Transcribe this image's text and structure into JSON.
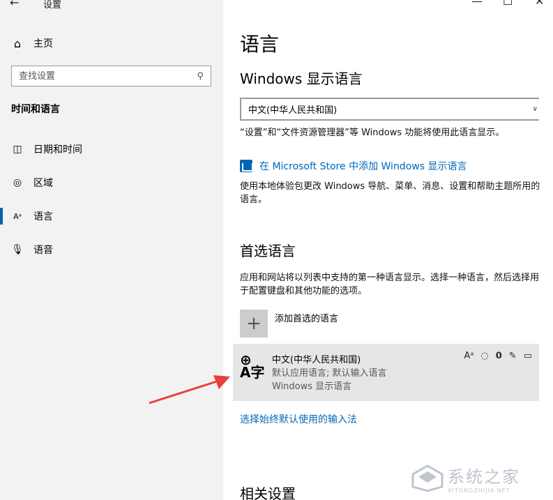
{
  "window": {
    "title": "设置",
    "back_glyph": "←",
    "minimize_glyph": "—",
    "maximize_glyph": "☐",
    "close_glyph": "✕"
  },
  "sidebar": {
    "home_label": "主页",
    "search_placeholder": "查找设置",
    "section_title": "时间和语言",
    "items": [
      {
        "label": "日期和时间",
        "icon": "calendar-clock-icon"
      },
      {
        "label": "区域",
        "icon": "globe-region-icon"
      },
      {
        "label": "语言",
        "icon": "language-icon"
      },
      {
        "label": "语音",
        "icon": "microphone-icon"
      }
    ],
    "active_index": 2
  },
  "main": {
    "page_title": "语言",
    "display_lang": {
      "heading": "Windows 显示语言",
      "selected": "中文(中华人民共和国)",
      "note": "“设置”和“文件资源管理器”等 Windows 功能将使用此语言显示。",
      "store_link": "在 Microsoft Store 中添加 Windows 显示语言",
      "store_note": "使用本地体验包更改 Windows 导航、菜单、消息、设置和帮助主题所用的语言。"
    },
    "preferred": {
      "heading": "首选语言",
      "note": "应用和网站将以列表中支持的第一种语言显示。选择一种语言，然后选择用于配置键盘和其他功能的选项。",
      "add_label": "添加首选的语言",
      "language": {
        "glyph_top": "⊕",
        "glyph_bottom": "A字",
        "name": "中文(中华人民共和国)",
        "sub1": "默认应用语言; 默认输入语言",
        "sub2": "Windows 显示语言"
      },
      "input_link": "选择始终默认使用的输入法"
    },
    "related_heading": "相关设置"
  },
  "watermark": {
    "cn": "系统之家",
    "en": "XITONGZHIJIA.NET"
  },
  "colors": {
    "accent": "#0067b8",
    "arrow": "#e8413c",
    "sidebar_bg": "#f2f2f2",
    "card_bg": "#e6e6e6"
  }
}
